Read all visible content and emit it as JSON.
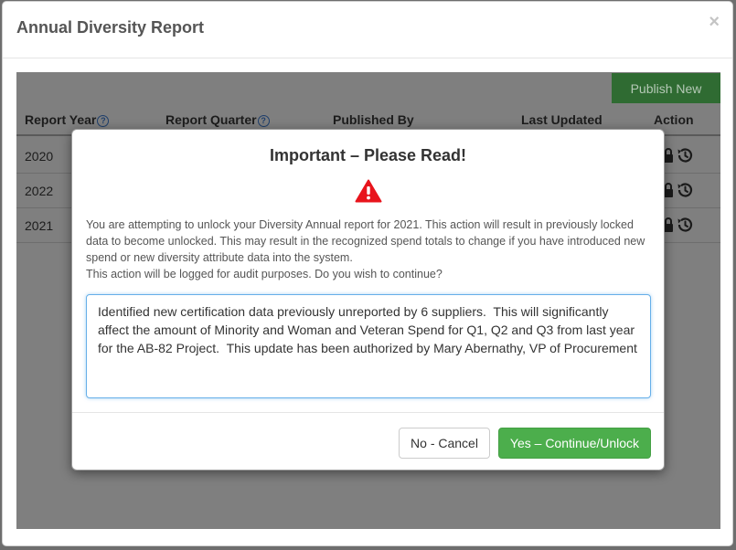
{
  "outer_modal": {
    "title": "Annual Diversity Report",
    "close_glyph": "×"
  },
  "toolbar": {
    "publish_label": "Publish New"
  },
  "table": {
    "headers": {
      "report_year": "Report Year",
      "report_quarter": "Report Quarter",
      "published_by": "Published By",
      "last_updated": "Last Updated",
      "action": "Action"
    },
    "help_glyph": "?",
    "rows": [
      {
        "year": "2020"
      },
      {
        "year": "2022"
      },
      {
        "year": "2021"
      }
    ]
  },
  "dialog": {
    "title": "Important – Please Read!",
    "message_line1": "You are attempting to unlock your Diversity Annual report for 2021. This action will result in previously locked data to become unlocked. This may result in the recognized spend totals to change if you have introduced new spend or new diversity attribute data into the system.",
    "message_line2": "This action will be logged for audit purposes. Do you wish to continue?",
    "textarea_value": "Identified new certification data previously unreported by 6 suppliers.  This will significantly affect the amount of Minority and Woman and Veteran Spend for Q1, Q2 and Q3 from last year for the AB-82 Project.  This update has been authorized by Mary Abernathy, VP of Procurement",
    "cancel_label": "No - Cancel",
    "confirm_label": "Yes – Continue/Unlock"
  },
  "icons": {
    "warning": "warning-triangle-icon",
    "lock": "lock-icon",
    "history": "history-icon",
    "help": "help-circle-icon",
    "close": "close-icon"
  },
  "colors": {
    "confirm_green": "#4cae4c",
    "publish_green": "#2f6b32",
    "warning_red": "#e8141c",
    "focus_blue": "#66afe9"
  }
}
